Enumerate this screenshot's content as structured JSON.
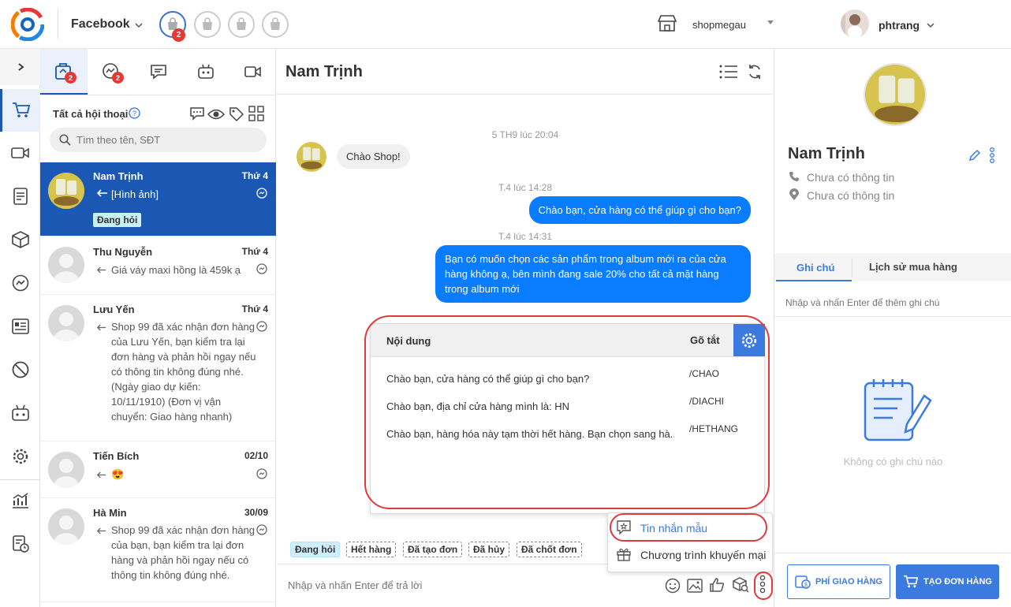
{
  "topbar": {
    "platform": "Facebook",
    "shop_badge": "2",
    "shop_name": "shopmegau",
    "user_name": "phtrang"
  },
  "conv_tabs": [
    {
      "icon": "shop-messages-icon",
      "badge": "2"
    },
    {
      "icon": "messenger-icon",
      "badge": "2"
    },
    {
      "icon": "comment-icon",
      "badge": ""
    },
    {
      "icon": "bot-icon",
      "badge": ""
    },
    {
      "icon": "video-icon",
      "badge": ""
    }
  ],
  "filter": {
    "title": "Tất cả hội thoại",
    "search_placeholder": "Tìm theo tên, SĐT"
  },
  "conversations": [
    {
      "name": "Nam Trịnh",
      "day": "Thứ 4",
      "preview": "[Hình ảnh]",
      "tag": "Đang hỏi"
    },
    {
      "name": "Thu Nguyễn",
      "day": "Thứ 4",
      "preview": "Giá váy maxi hồng là 459k ạ"
    },
    {
      "name": "Lưu Yến",
      "day": "Thứ 4",
      "preview": "Shop 99 đã xác nhận đơn hàng của Lưu Yến, bạn kiểm tra lại đơn hàng và phản hồi ngay nếu có thông tin không đúng nhé. (Ngày giao dự kiến: 10/11/1910) (Đơn vị vận chuyển: Giao hàng nhanh)"
    },
    {
      "name": "Tiến Bích",
      "day": "02/10",
      "preview": "😍"
    },
    {
      "name": "Hà Min",
      "day": "30/09",
      "preview": "Shop 99 đã xác nhận đơn hàng của bạn, bạn kiểm tra lại đơn hàng và phản hồi ngay nếu có thông tin không đúng nhé."
    }
  ],
  "chat": {
    "contact_name": "Nam Trịnh",
    "messages": [
      {
        "kind": "time",
        "text": "5 TH9 lúc 20:04"
      },
      {
        "kind": "in",
        "text": "Chào Shop!"
      },
      {
        "kind": "time",
        "text": "T.4 lúc 14:28"
      },
      {
        "kind": "out",
        "text": "Chào bạn, cửa hàng có thể giúp gì cho bạn?"
      },
      {
        "kind": "time",
        "text": "T.4 lúc 14:31"
      },
      {
        "kind": "out",
        "text": "Bạn có muốn chọn các sản phẩm trong album mới ra của cửa hàng không ạ, bên mình đang sale 20% cho tất cả mặt hàng trong album mới"
      }
    ],
    "quick_tags": [
      "Đang hỏi",
      "Hết hàng",
      "Đã tạo đơn",
      "Đã hủy",
      "Đã chốt đơn"
    ],
    "input_placeholder": "Nhập và nhấn Enter để trả lời"
  },
  "templates": {
    "col_content": "Nội dung",
    "col_shortcut": "Gõ tắt",
    "rows": [
      {
        "content": "Chào bạn, cửa hàng có thể giúp gì cho bạn?",
        "shortcut": "/CHAO"
      },
      {
        "content": "Chào bạn, địa chỉ cửa hàng mình là: HN",
        "shortcut": "/DIACHI"
      },
      {
        "content": "Chào bạn, hàng hóa này tạm thời hết hàng. Bạn chọn sang hà...",
        "shortcut": "/HETHANG"
      }
    ]
  },
  "menu": {
    "items": [
      "Tin nhắn mẫu",
      "Chương trình khuyến mại"
    ]
  },
  "profile": {
    "name": "Nam Trịnh",
    "phone": "Chưa có thông tin",
    "address": "Chưa có thông tin",
    "tabs": [
      "Ghi chú",
      "Lịch sử mua hàng"
    ],
    "note_placeholder": "Nhập và nhấn Enter để thêm ghi chú",
    "empty_notes": "Không có ghi chú nào",
    "btn_shipping": "PHÍ GIAO HÀNG",
    "btn_order": "TẠO ĐƠN HÀNG"
  },
  "colors": {
    "primary": "#1a58b3",
    "bubble": "#0a7cff",
    "highlight": "#e0393e"
  }
}
